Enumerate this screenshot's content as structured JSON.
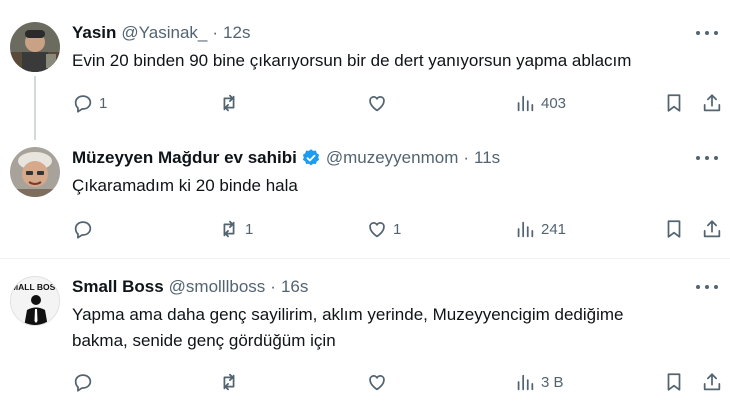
{
  "tweets": [
    {
      "name": "Yasin",
      "handle": "@Yasinak_",
      "time": "12s",
      "text": "Evin 20 binden 90 bine çıkarıyorsun bir de dert yanıyorsun yapma ablacım",
      "replies": "1",
      "retweets": "",
      "likes": "",
      "views": "403"
    },
    {
      "name": "Müzeyyen Mağdur ev sahibi",
      "handle": "@muzeyyenmom",
      "time": "11s",
      "text": "Çıkaramadım ki 20 binde hala",
      "replies": "",
      "retweets": "1",
      "likes": "1",
      "views": "241",
      "verified": true
    },
    {
      "name": "Small Boss",
      "handle": "@smolllboss",
      "time": "16s",
      "text_line1": "Yapma ama daha genç sayilirim, aklım yerinde, Muzeyyencigim dediğime",
      "text_line2": "bakma, senide genç gördüğüm için",
      "avatar_text": "MALL BOSS",
      "replies": "",
      "retweets": "",
      "likes": "",
      "views": "3 B"
    }
  ],
  "dot": "·",
  "colors": {
    "verified": "#1d9bf0",
    "text": "#0f1419",
    "muted": "#536471",
    "thread_line": "#cfd9de"
  }
}
